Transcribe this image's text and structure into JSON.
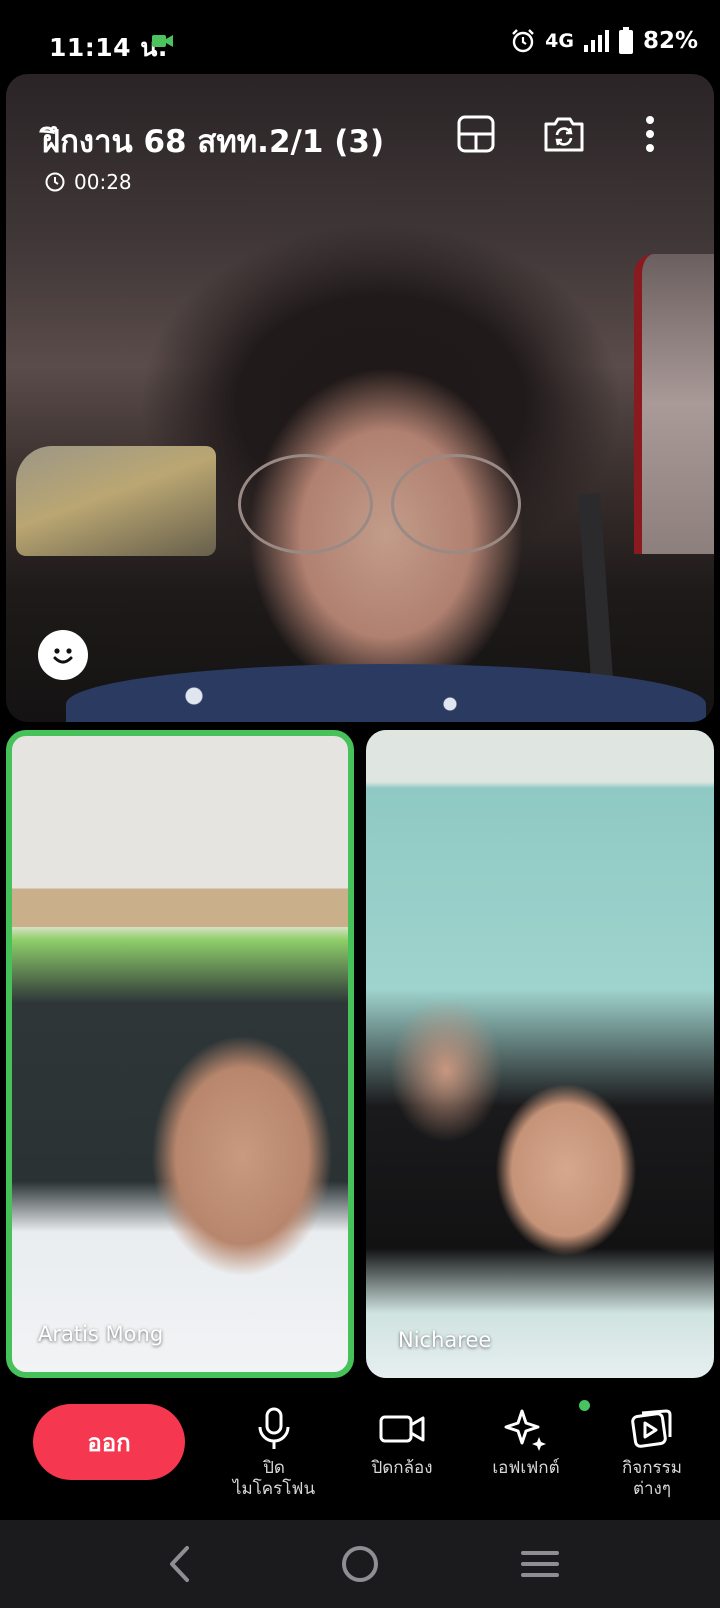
{
  "status_bar": {
    "time": "11:14 น.",
    "network": "4G",
    "battery": "82%",
    "icons": [
      "video-camera-icon",
      "alarm-icon",
      "signal-icon",
      "battery-icon"
    ]
  },
  "call": {
    "title": "ฝึกงาน 68 สทท.2/1 (3)",
    "duration": "00:28"
  },
  "participants": [
    {
      "name": "Aratis Mong",
      "speaking": true
    },
    {
      "name": "Nicharee",
      "speaking": false
    }
  ],
  "controls": {
    "leave_label": "ออก",
    "mic_label": "ปิด\nไมโครโฟน",
    "camera_label": "ปิดกล้อง",
    "effects_label": "เอฟเฟกต์",
    "activities_label": "กิจกรรม\nต่างๆ"
  },
  "colors": {
    "leave": "#f5384f",
    "speaking_border": "#47c25a",
    "status_icon": "#4cc35c"
  }
}
